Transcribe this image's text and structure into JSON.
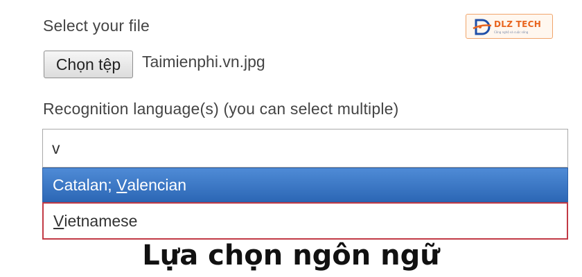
{
  "form": {
    "select_file_label": "Select your file",
    "choose_file_button": "Chọn tệp",
    "file_name": "Taimienphi.vn.jpg",
    "recognition_label": "Recognition language(s) (you can select multiple)",
    "language_input_value": "v"
  },
  "dropdown": {
    "options": [
      {
        "prefix": "Catalan; ",
        "underlined": "V",
        "rest": "alencian",
        "state": "highlighted"
      },
      {
        "prefix": "",
        "underlined": "V",
        "rest": "ietnamese",
        "state": "outlined"
      }
    ]
  },
  "caption": "Lựa chọn ngôn ngữ",
  "logo": {
    "text": "DLZ TECH",
    "tagline": "Công nghệ và cuộc sống"
  },
  "colors": {
    "highlight_blue": "#3a75c4",
    "outline_red": "#c23a45",
    "logo_orange": "#e8641e"
  }
}
